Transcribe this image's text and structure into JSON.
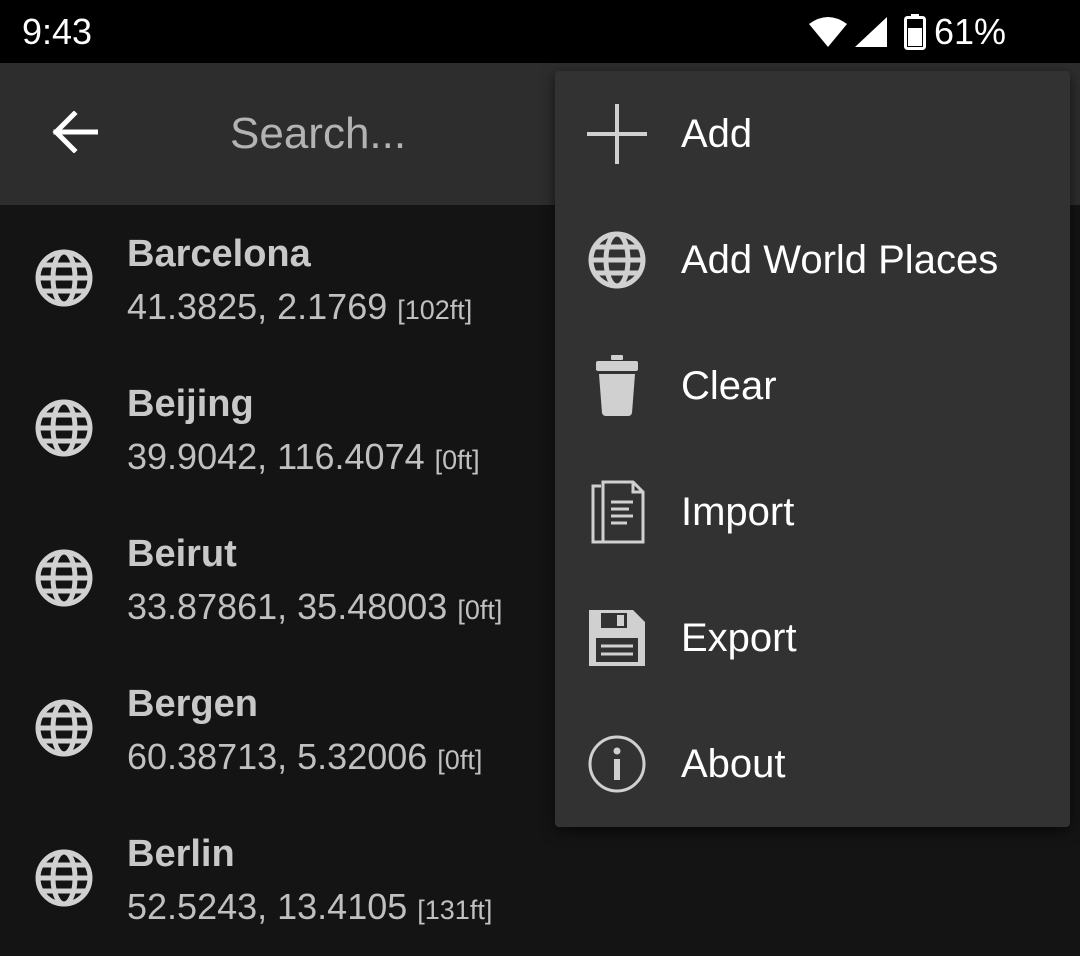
{
  "status_bar": {
    "time": "9:43",
    "battery_percent": "61%",
    "icons": [
      "wifi-icon",
      "signal-icon",
      "battery-icon"
    ]
  },
  "app_bar": {
    "back_icon": "arrow-left-icon",
    "search_placeholder": "Search..."
  },
  "places": [
    {
      "name": "Barcelona",
      "coords": "41.3825, 2.1769",
      "elevation": "[102ft]",
      "icon": "globe-icon"
    },
    {
      "name": "Beijing",
      "coords": "39.9042, 116.4074",
      "elevation": "[0ft]",
      "icon": "globe-icon"
    },
    {
      "name": "Beirut",
      "coords": "33.87861, 35.48003",
      "elevation": "[0ft]",
      "icon": "globe-icon"
    },
    {
      "name": "Bergen",
      "coords": "60.38713, 5.32006",
      "elevation": "[0ft]",
      "icon": "globe-icon"
    },
    {
      "name": "Berlin",
      "coords": "52.5243, 13.4105",
      "elevation": "[131ft]",
      "icon": "globe-icon"
    }
  ],
  "menu": {
    "items": [
      {
        "label": "Add",
        "icon": "plus-icon"
      },
      {
        "label": "Add World Places",
        "icon": "globe-icon"
      },
      {
        "label": "Clear",
        "icon": "trash-icon"
      },
      {
        "label": "Import",
        "icon": "import-icon"
      },
      {
        "label": "Export",
        "icon": "save-icon"
      },
      {
        "label": "About",
        "icon": "info-icon"
      }
    ]
  },
  "colors": {
    "background": "#141414",
    "app_bar": "#2d2d2d",
    "menu_background": "#323232",
    "text_primary": "#ffffff",
    "text_secondary": "#c0c0c0"
  }
}
